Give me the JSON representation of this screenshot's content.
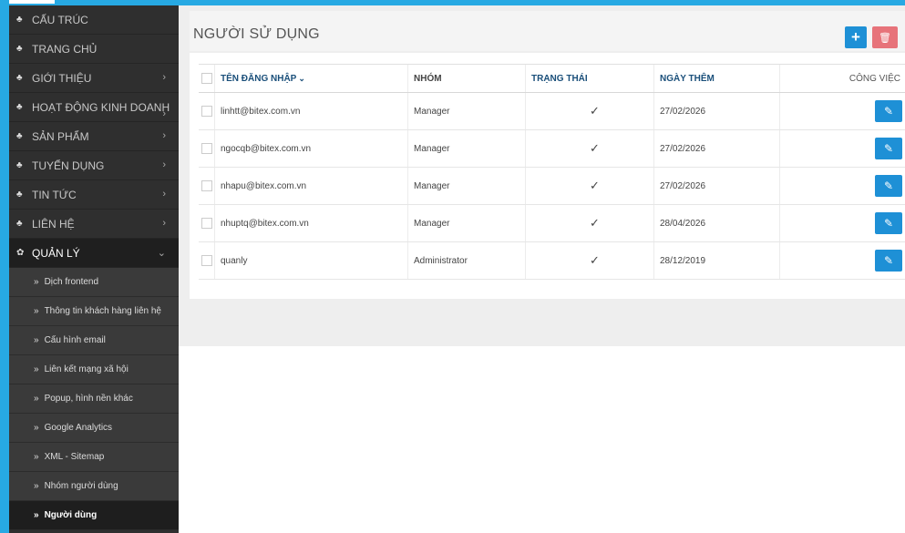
{
  "sidebar": {
    "menu": [
      {
        "label": "CẤU TRÚC",
        "icon": "sitemap-icon",
        "chevron": false
      },
      {
        "label": "TRANG CHỦ",
        "icon": "sitemap-icon",
        "chevron": false
      },
      {
        "label": "GIỚI THIỆU",
        "icon": "sitemap-icon",
        "chevron": true
      },
      {
        "label": "HOẠT ĐỘNG KINH DOANH",
        "icon": "sitemap-icon",
        "chevron": true
      },
      {
        "label": "SẢN PHẨM",
        "icon": "sitemap-icon",
        "chevron": true
      },
      {
        "label": "TUYỂN DỤNG",
        "icon": "sitemap-icon",
        "chevron": true
      },
      {
        "label": "TIN TỨC",
        "icon": "sitemap-icon",
        "chevron": true
      },
      {
        "label": "LIÊN HỆ",
        "icon": "sitemap-icon",
        "chevron": true
      },
      {
        "label": "QUẢN LÝ",
        "icon": "gear-icon",
        "chevron": "down"
      }
    ],
    "submenu": [
      {
        "label": "Dịch frontend"
      },
      {
        "label": "Thông tin khách hàng liên hệ"
      },
      {
        "label": "Cấu hình email"
      },
      {
        "label": "Liên kết mạng xã hội"
      },
      {
        "label": "Popup, hình nền khác"
      },
      {
        "label": "Google Analytics"
      },
      {
        "label": "XML - Sitemap"
      },
      {
        "label": "Nhóm người dùng"
      },
      {
        "label": "Người dùng"
      }
    ]
  },
  "header": {
    "title": "NGƯỜI SỬ DỤNG",
    "add_icon": "+",
    "delete_icon": "🗑"
  },
  "table": {
    "columns": {
      "username": "TÊN ĐĂNG NHẬP",
      "group": "NHÓM",
      "status": "TRẠNG THÁI",
      "date_added": "NGÀY THÊM",
      "actions": "CÔNG VIỆC"
    },
    "rows": [
      {
        "username": "linhtt@bitex.com.vn",
        "group": "Manager",
        "status": "✓",
        "date_added": "27/02/2026"
      },
      {
        "username": "ngocqb@bitex.com.vn",
        "group": "Manager",
        "status": "✓",
        "date_added": "27/02/2026"
      },
      {
        "username": "nhapu@bitex.com.vn",
        "group": "Manager",
        "status": "✓",
        "date_added": "27/02/2026"
      },
      {
        "username": "nhuptq@bitex.com.vn",
        "group": "Manager",
        "status": "✓",
        "date_added": "28/04/2026"
      },
      {
        "username": "quanly",
        "group": "Administrator",
        "status": "✓",
        "date_added": "28/12/2019"
      }
    ]
  },
  "colors": {
    "accent_blue": "#1e90d6",
    "delete_red": "#e7737a",
    "sidebar_bg": "#2f2f2f",
    "header_link": "#1a4f7a"
  }
}
